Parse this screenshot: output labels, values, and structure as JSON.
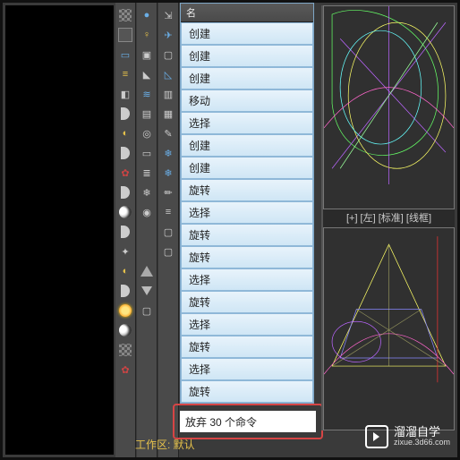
{
  "left_icons_a": [
    "grid",
    "panel",
    "panel2",
    "layers",
    "cube",
    "half",
    "pot",
    "half2",
    "moon",
    "half3",
    "flare",
    "pot2",
    "tex",
    "half4",
    "sun",
    "moon2",
    "dots",
    "gear",
    "half5"
  ],
  "left_icons_b": [
    "sphere",
    "light",
    "cam",
    "ruler",
    "wave",
    "layer",
    "tgt",
    "sel",
    "list",
    "snow",
    "eye",
    "blank",
    "blank2",
    "blank3",
    "blank4",
    "tri",
    "funnel",
    "folder"
  ],
  "left_icons_c": [
    "link",
    "pin",
    "square",
    "tri2",
    "square2",
    "grid2",
    "paint",
    "snow2",
    "snow3",
    "edit",
    "bars",
    "box",
    "box2"
  ],
  "history": {
    "header": "名",
    "items": [
      "创建",
      "创建",
      "创建",
      "移动",
      "选择",
      "创建",
      "创建",
      "旋转",
      "选择",
      "旋转",
      "旋转",
      "选择",
      "旋转",
      "选择",
      "旋转",
      "选择",
      "旋转"
    ]
  },
  "undo_label": "放弃 30 个命令",
  "viewport_label": "[+] [左] [标准] [线框]",
  "status_text": "工作区: 默认",
  "watermark": {
    "brand": "溜溜自学",
    "url": "zixue.3d66.com"
  },
  "colors": {
    "accent": "#d64545",
    "list_bg": "#cfe6f5",
    "brand_gold": "#e6c24a"
  }
}
